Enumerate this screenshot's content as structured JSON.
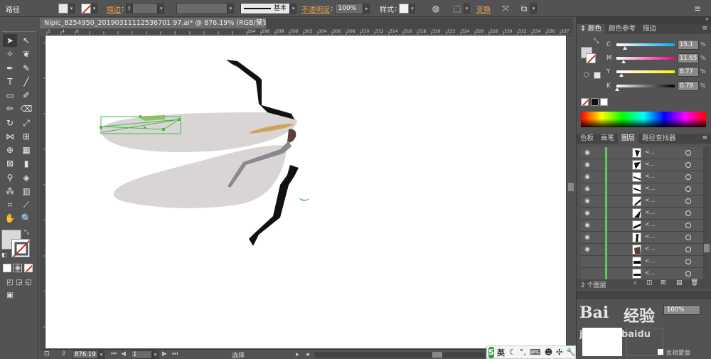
{
  "control_bar": {
    "selection_label": "路径",
    "stroke_label": "描边",
    "stroke_profile": "基本",
    "opacity_label": "不透明度",
    "opacity_value": "100%",
    "style_label": "样式",
    "transform_label": "变换"
  },
  "document": {
    "tab_title": "Nipic_8254950_20190311112536701 97.ai* @ 876.19% (RGB/预览)",
    "close_glyph": "×"
  },
  "ruler": {
    "h_ticks": [
      "2",
      "4",
      "6",
      "",
      "",
      "",
      "",
      "",
      "",
      "",
      "",
      "",
      "",
      "",
      "294",
      "296",
      "298",
      "300",
      "302",
      "304",
      "306",
      "308",
      "310",
      "312",
      "314",
      "316",
      "318",
      "320",
      "322",
      "324",
      "326",
      "328",
      "330",
      "332",
      "334",
      "336",
      "337"
    ]
  },
  "status_bar": {
    "zoom": "876.19",
    "page": "1",
    "mode": "选择"
  },
  "panels": {
    "color_tabs": [
      "颜色",
      "颜色参考",
      "描边"
    ],
    "cmyk": [
      {
        "label": "C",
        "value": "15.1",
        "fraction": 0.15,
        "track": "linear-gradient(to right,#fff,#00aeef)"
      },
      {
        "label": "M",
        "value": "11.65",
        "fraction": 0.12,
        "track": "linear-gradient(to right,#fff,#ec008c)"
      },
      {
        "label": "Y",
        "value": "8.77",
        "fraction": 0.09,
        "track": "linear-gradient(to right,#fff,#fff200)"
      },
      {
        "label": "K",
        "value": "0.79",
        "fraction": 0.01,
        "track": "linear-gradient(to right,#fff,#000)"
      }
    ],
    "percent_sign": "%",
    "layers_tabs": [
      "色板",
      "画笔",
      "图层",
      "路径查找器"
    ],
    "layer_count": "2 个图层",
    "layer_rows": [
      {
        "name": "<...",
        "visible": true
      },
      {
        "name": "<...",
        "visible": true
      },
      {
        "name": "<...",
        "visible": true
      },
      {
        "name": "<...",
        "visible": true
      },
      {
        "name": "<...",
        "visible": true
      },
      {
        "name": "<...",
        "visible": true
      },
      {
        "name": "<...",
        "visible": true
      },
      {
        "name": "<...",
        "visible": true
      },
      {
        "name": "<...",
        "visible": true
      },
      {
        "name": "<...",
        "visible": false
      },
      {
        "name": "<...",
        "visible": false
      }
    ],
    "nav_zoom": "100%",
    "nav_option": "反相蒙版"
  },
  "watermark": {
    "line1": "Bai",
    "line2": "经验",
    "line3": "jingyan.baidu"
  },
  "ime": {
    "lang": "英"
  },
  "colors": {
    "wing": "#d8d4d4",
    "leg": "#111111",
    "accent": "#cfa35a",
    "brown": "#5a4038",
    "gray_leg": "#8a8890",
    "selection": "#4ab84a",
    "teal": "#3aa0a8"
  }
}
